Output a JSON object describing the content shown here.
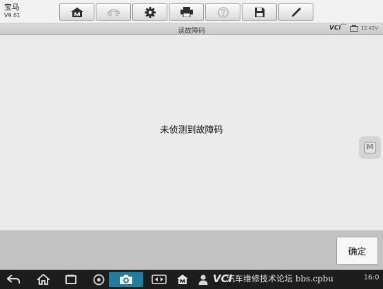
{
  "vehicle": {
    "make": "宝马",
    "version": "V9.61"
  },
  "toolbar": {
    "buttons": [
      {
        "icon": "home-m-icon"
      },
      {
        "icon": "vehicle-swap-icon",
        "state": "disabled"
      },
      {
        "icon": "gear-icon"
      },
      {
        "icon": "print-icon"
      },
      {
        "icon": "help-icon",
        "state": "disabled"
      },
      {
        "icon": "save-icon"
      },
      {
        "icon": "pen-icon"
      }
    ]
  },
  "status": {
    "title": "读故障码",
    "vci_logo": "VCI",
    "voltage": "12.42V"
  },
  "main": {
    "message": "未侦测到故障码"
  },
  "actions": {
    "ok_label": "确定"
  },
  "taskbar": {
    "vci_logo": "VCI",
    "watermark": "汽车维修技术论坛 bbs.cpbu",
    "clock": "16:0"
  },
  "colors": {
    "header_bg": "#f2f2f2",
    "content_bg": "#ebebeb",
    "action_bar_bg": "#c2c2c2",
    "nav_bar_bg": "#1d1d1d",
    "camera_accent": "#1f7e9e",
    "vci_green": "#3e9a2e"
  }
}
